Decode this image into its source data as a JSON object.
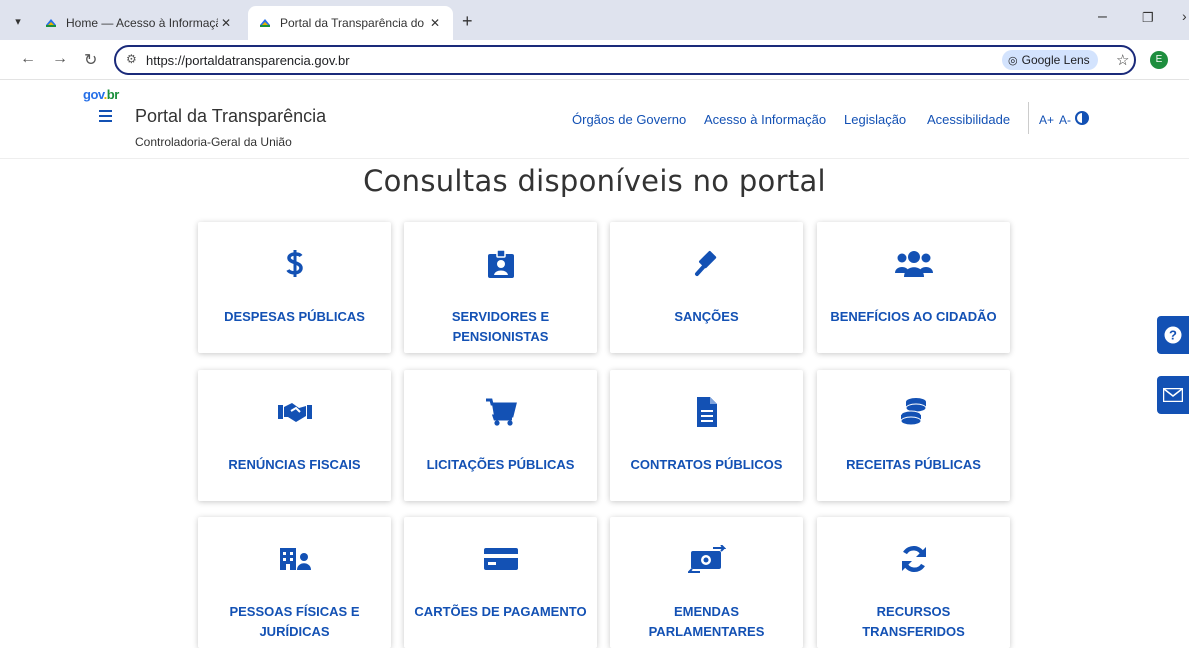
{
  "browser": {
    "tabs": [
      {
        "title": "Home — Acesso à Informação",
        "active": false
      },
      {
        "title": "Portal da Transparência do Gove",
        "active": true
      }
    ],
    "tab_close": "✕",
    "new_tab": "+",
    "url": "https://portaldatransparencia.gov.br",
    "lens_label": "Google Lens",
    "profile_initial": "E"
  },
  "header": {
    "logo_parts": [
      "gov",
      ".",
      "br"
    ],
    "site_title": "Portal da Transparência",
    "site_subtitle": "Controladoria-Geral da União",
    "nav": [
      "Órgãos de Governo",
      "Acesso à Informação",
      "Legislação",
      "Acessibilidade"
    ],
    "font_increase": "A+",
    "font_decrease": "A-"
  },
  "main": {
    "title": "Consultas disponíveis no portal",
    "cards": [
      {
        "label": "DESPESAS PÚBLICAS",
        "icon": "dollar-icon"
      },
      {
        "label": "SERVIDORES E PENSIONISTAS",
        "icon": "id-badge-icon"
      },
      {
        "label": "SANÇÕES",
        "icon": "gavel-icon"
      },
      {
        "label": "BENEFÍCIOS AO CIDADÃO",
        "icon": "users-icon"
      },
      {
        "label": "RENÚNCIAS FISCAIS",
        "icon": "handshake-icon"
      },
      {
        "label": "LICITAÇÕES PÚBLICAS",
        "icon": "shopping-cart-icon"
      },
      {
        "label": "CONTRATOS PÚBLICOS",
        "icon": "document-icon"
      },
      {
        "label": "RECEITAS PÚBLICAS",
        "icon": "coins-icon"
      },
      {
        "label": "PESSOAS FÍSICAS E JURÍDICAS",
        "icon": "building-person-icon"
      },
      {
        "label": "CARTÕES DE PAGAMENTO",
        "icon": "credit-card-icon"
      },
      {
        "label": "EMENDAS PARLAMENTARES",
        "icon": "money-transfer-icon"
      },
      {
        "label": "RECURSOS TRANSFERIDOS",
        "icon": "sync-icon"
      }
    ]
  },
  "floating": [
    {
      "icon": "help-icon"
    },
    {
      "icon": "mail-icon"
    }
  ],
  "colors": {
    "accent": "#1351b4",
    "text": "#333333",
    "tabbar": "#dfe3ee"
  }
}
